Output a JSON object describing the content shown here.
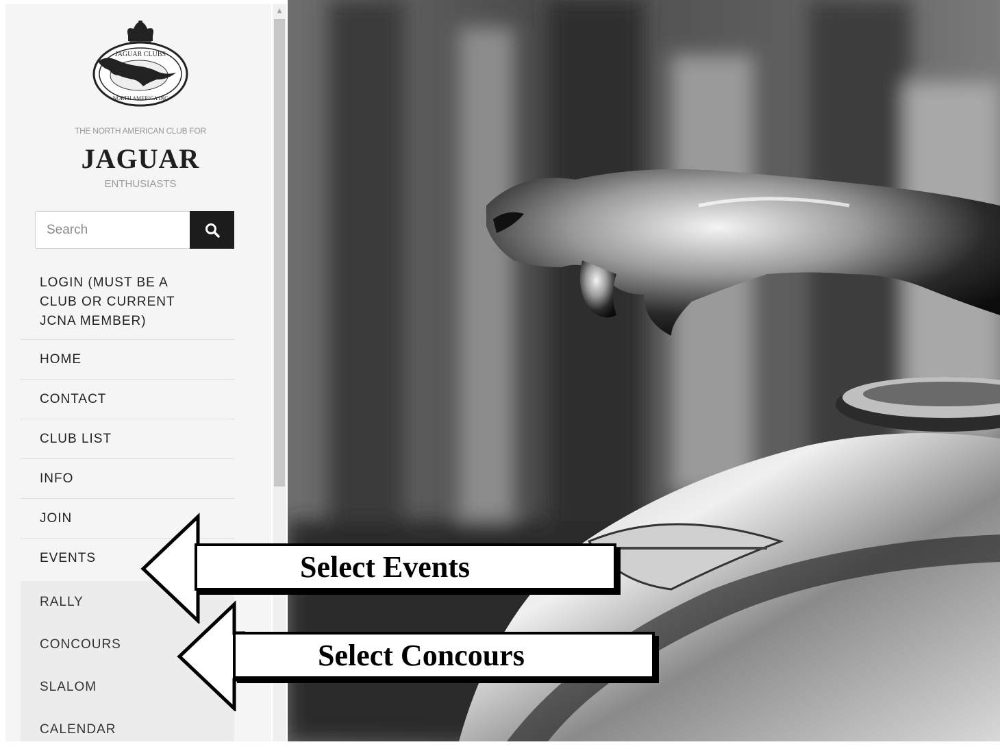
{
  "sidebar": {
    "logo_alt": "Jaguar Clubs of North America Inc.",
    "logo_ring_text": "JAGUAR CLUBS OF NORTH AMERICA INC",
    "tagline_top": "THE NORTH AMERICAN CLUB FOR",
    "brand": "JAGUAR",
    "tagline_bottom": "ENTHUSIASTS",
    "search": {
      "placeholder": "Search",
      "button_icon": "search-icon"
    },
    "menu": {
      "login": "LOGIN (MUST BE A\nCLUB OR CURRENT\nJCNA MEMBER)",
      "items": [
        {
          "label": "HOME"
        },
        {
          "label": "CONTACT"
        },
        {
          "label": "CLUB LIST"
        },
        {
          "label": "INFO"
        },
        {
          "label": "JOIN"
        },
        {
          "label": "EVENTS"
        }
      ],
      "subitems": [
        {
          "label": "RALLY"
        },
        {
          "label": "CONCOURS"
        },
        {
          "label": "SLALOM"
        },
        {
          "label": "CALENDAR"
        }
      ]
    }
  },
  "annotations": {
    "events": "Select Events",
    "concours": "Select Concours"
  },
  "colors": {
    "sidebar_bg": "#f5f5f5",
    "search_button": "#1c1c1c",
    "text": "#222222"
  }
}
